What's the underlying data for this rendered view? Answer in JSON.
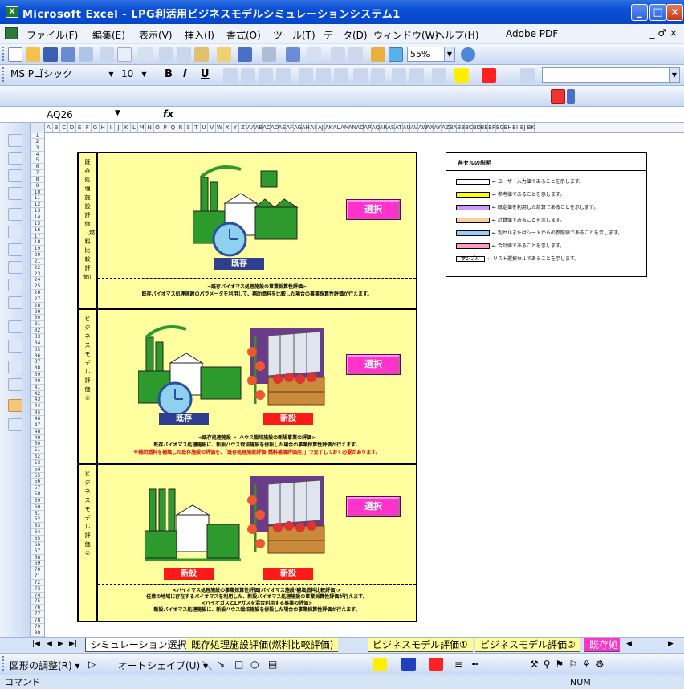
{
  "window": {
    "title": "Microsoft Excel - LPG利活用ビジネスモデルシミュレーションシステム1",
    "app_icon": "X"
  },
  "menu": {
    "items": [
      "ファイル(F)",
      "編集(E)",
      "表示(V)",
      "挿入(I)",
      "書式(O)",
      "ツール(T)",
      "データ(D)",
      "ウィンドウ(W)",
      "ヘルプ(H)"
    ],
    "adobe": "Adobe PDF",
    "mdi": "_ ♂ ×"
  },
  "toolbar": {
    "zoom": "55%",
    "font_name": "MS Pゴシック",
    "font_size": "10",
    "bold": "B",
    "italic": "I",
    "underline": "U"
  },
  "formula_bar": {
    "name_box": "AQ26",
    "fx": "fx"
  },
  "columns": [
    "A",
    "B",
    "C",
    "D",
    "E",
    "F",
    "G",
    "H",
    "I",
    "J",
    "K",
    "L",
    "M",
    "N",
    "O",
    "P",
    "Q",
    "R",
    "S",
    "T",
    "U",
    "V",
    "W",
    "X",
    "Y",
    "Z",
    "AA",
    "AB",
    "AC",
    "AD",
    "AE",
    "AF",
    "AG",
    "AH",
    "AI",
    "AJ",
    "AK",
    "AL",
    "AM",
    "AN",
    "AO",
    "AP",
    "AQ",
    "AR",
    "AS",
    "AT",
    "AU",
    "AV",
    "AW",
    "AX",
    "AY",
    "AZ",
    "BA",
    "BB",
    "BC",
    "BD",
    "BE",
    "BF",
    "BG",
    "BH",
    "BI",
    "BJ",
    "BK"
  ],
  "sections": [
    {
      "label": "既存処理施設評価（燃料比較評価）",
      "tags": [
        {
          "text": "既存",
          "color": "blue"
        }
      ],
      "select": "選択",
      "captions": [
        {
          "text": "<既存バイオマス処理施設の事業採算性評価>",
          "red": false
        },
        {
          "text": "既存バイオマス処理施設のパラメータを利用して、補助燃料を比較した場合の事業採算性評価が行えます。",
          "red": false
        }
      ]
    },
    {
      "label": "ビジネスモデル評価①",
      "tags": [
        {
          "text": "既存",
          "color": "blue"
        },
        {
          "text": "新設",
          "color": "red"
        }
      ],
      "select": "選択",
      "captions": [
        {
          "text": "<既存処理施設 ・ ハウス栽培施設の新規事業の評価>",
          "red": false
        },
        {
          "text": "既存バイオマス処理施設に、新設ハウス栽培施設を併設した場合の事業採算性評価が行えます。",
          "red": false
        },
        {
          "text": "※補助燃料を補填した既存施設の評価を、「既存処理施設評価(燃料補填評価用)」で完了しておく必要があります。",
          "red": true
        }
      ]
    },
    {
      "label": "ビジネスモデル評価②",
      "tags": [
        {
          "text": "新設",
          "color": "red"
        },
        {
          "text": "新設",
          "color": "red"
        }
      ],
      "select": "選択",
      "captions": [
        {
          "text": "<バイオマス処理施設の事業採算性評価(バイオマス施設/補填燃料比較評価)>",
          "red": false
        },
        {
          "text": "任意の地域に存在するバイオマスを利用した、新設バイオマス処理施設の事業採算性評価が行えます。",
          "red": false
        },
        {
          "text": "<バイオガスとLPガスを混合利用する事業の評価>",
          "red": false
        },
        {
          "text": "新設バイオマス処理施設に、新設ハウス栽培施設を併設した場合の事業採算性評価が行えます。",
          "red": false
        }
      ]
    }
  ],
  "legend": {
    "title": "各セルの説明",
    "rows": [
      {
        "color": "#ffffff",
        "label": "← ユーザー入力値であることを示します。"
      },
      {
        "color": "#ffff00",
        "label": "← 参考値であることを示します。"
      },
      {
        "color": "#cc99ff",
        "label": "← 既定値を利用した計算であることを示します。"
      },
      {
        "color": "#ffcc99",
        "label": "← 計算値であることを示します。"
      },
      {
        "color": "#99ccff",
        "label": "← 別セルまたはシートからの参照値であることを示します。"
      },
      {
        "color": "#ff99cc",
        "label": "← 合計値であることを示します。"
      },
      {
        "color": "#ffffff",
        "sample": "サンプル",
        "label": "← リスト選択セルであることを示します。"
      }
    ]
  },
  "sheet_tabs": [
    {
      "label": "シミュレーション選択",
      "active": true
    },
    {
      "label": "既存処理施設評価(燃料比較評価)",
      "color": "#ffff99"
    },
    {
      "label": "ビジネスモデル評価①",
      "color": "#ffff99"
    },
    {
      "label": "ビジネスモデル評価②",
      "color": "#ffff99"
    },
    {
      "label": "既存処",
      "color": "#ff33cc"
    }
  ],
  "drawing_toolbar": {
    "adjust": "図形の調整(R) ▾",
    "autoshape": "オートシェイプ(U) ▾"
  },
  "status": {
    "mode": "コマンド",
    "num": "NUM"
  }
}
